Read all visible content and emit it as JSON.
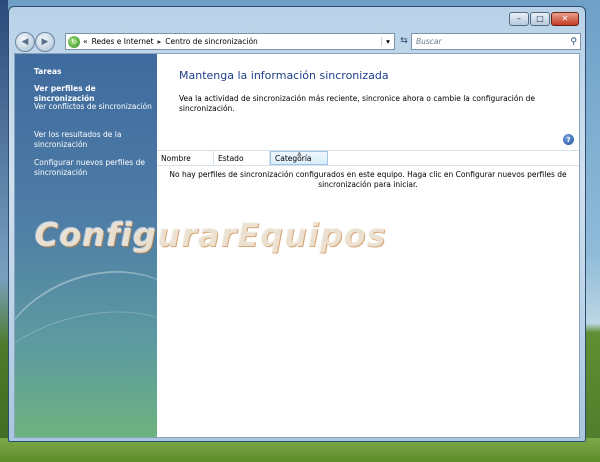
{
  "window": {
    "min_label": "–",
    "max_label": "□",
    "close_label": "✕"
  },
  "navigation": {
    "back_glyph": "◀",
    "forward_glyph": "▶",
    "breadcrumb_lead": "«",
    "breadcrumb": [
      "Redes e Internet",
      "Centro de sincronización"
    ],
    "breadcrumb_separator": "▸",
    "search_placeholder": "Buscar"
  },
  "sidebar": {
    "title": "Tareas",
    "items": [
      {
        "label": "Ver perfiles de sincronización",
        "selected": true
      },
      {
        "label": "Ver conflictos de sincronización",
        "selected": false
      },
      {
        "label": "Ver los resultados de la sincronización",
        "selected": false
      },
      {
        "label": "Configurar nuevos perfiles de sincronización",
        "selected": false
      }
    ]
  },
  "main": {
    "title": "Mantenga la información sincronizada",
    "description": "Vea la actividad de sincronización más reciente, sincronice ahora o cambie la configuración de sincronización.",
    "help_glyph": "?",
    "columns": [
      "Nombre",
      "Estado",
      "Categoría"
    ],
    "empty_message": "No hay perfiles de sincronización configurados en este equipo. Haga clic en Configurar nuevos perfiles de sincronización para iniciar."
  },
  "watermark": "ConfigurarEquipos",
  "icons": {
    "address_icon": "sync-center-icon",
    "search_icon": "magnifier-icon",
    "help_icon": "help-icon"
  },
  "colors": {
    "sidebar_top": "#3f6a9e",
    "sidebar_bottom": "#6db27f",
    "title_blue": "#1e3f8a",
    "close_red": "#c43b24"
  }
}
